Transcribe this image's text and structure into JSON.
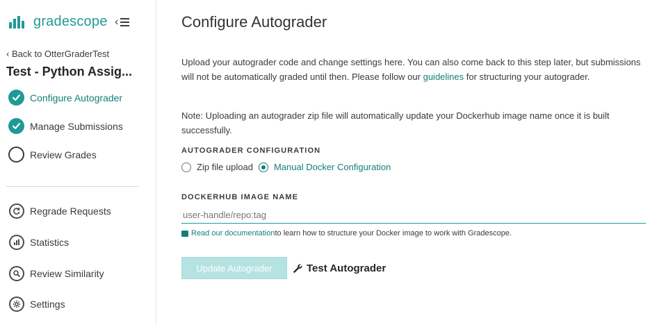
{
  "brand": {
    "name": "gradescope",
    "accent_color": "#1f9a96"
  },
  "sidebar": {
    "back_label": "Back to OtterGraderTest",
    "course_title": "Test - Python Assig...",
    "steps": [
      {
        "label": "Configure Autograder",
        "state": "complete",
        "active": true,
        "icon": "check-circle-icon"
      },
      {
        "label": "Manage Submissions",
        "state": "complete",
        "active": false,
        "icon": "check-circle-icon"
      },
      {
        "label": "Review Grades",
        "state": "pending",
        "active": false,
        "icon": "empty-circle-icon"
      }
    ],
    "tools": [
      {
        "label": "Regrade Requests",
        "icon": "regrade-icon"
      },
      {
        "label": "Statistics",
        "icon": "statistics-icon"
      },
      {
        "label": "Review Similarity",
        "icon": "similarity-icon"
      },
      {
        "label": "Settings",
        "icon": "gear-icon"
      }
    ]
  },
  "main": {
    "title": "Configure Autograder",
    "intro_before_link": "Upload your autograder code and change settings here. You can also come back to this step later, but submissions will not be automatically graded until then. Please follow our ",
    "intro_link": "guidelines",
    "intro_after_link": " for structuring your autograder.",
    "note": "Note: Uploading an autograder zip file will automatically update your Dockerhub image name once it is built successfully.",
    "config_label": "AUTOGRADER CONFIGURATION",
    "options": [
      {
        "label": "Zip file upload",
        "selected": false
      },
      {
        "label": "Manual Docker Configuration",
        "selected": true
      }
    ],
    "image_label": "DOCKERHUB IMAGE NAME",
    "image_placeholder": "user-handle/repo:tag",
    "doc_link": "Read our documentation",
    "doc_text": " to learn how to structure your Docker image to work with Gradescope.",
    "update_button": "Update Autograder",
    "test_button": "Test Autograder"
  }
}
